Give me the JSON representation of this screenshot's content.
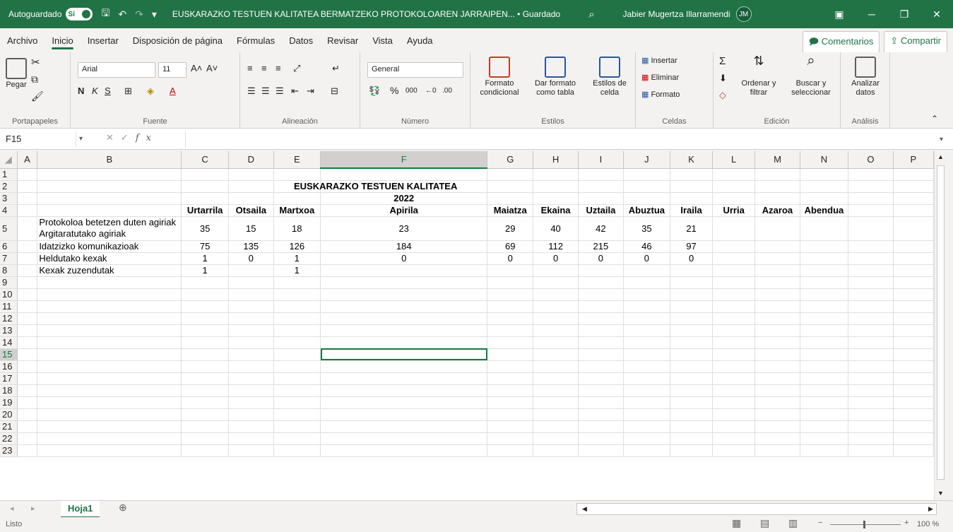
{
  "titlebar": {
    "autosave_label": "Autoguardado",
    "autosave_state": "Sí",
    "doc_title": "EUSKARAZKO TESTUEN KALITATEA BERMATZEKO PROTOKOLOAREN JARRAIPEN... • Guardado",
    "user_name": "Jabier Mugertza Illarramendi",
    "user_initials": "JM"
  },
  "menu": {
    "tabs": [
      "Archivo",
      "Inicio",
      "Insertar",
      "Disposición de página",
      "Fórmulas",
      "Datos",
      "Revisar",
      "Vista",
      "Ayuda"
    ],
    "active": "Inicio",
    "comments": "Comentarios",
    "share": "Compartir"
  },
  "ribbon": {
    "paste": "Pegar",
    "font_name": "Arial",
    "font_size": "11",
    "number_format": "General",
    "cond_format": "Formato condicional",
    "table_format": "Dar formato como tabla",
    "cell_styles": "Estilos de celda",
    "insert": "Insertar",
    "delete": "Eliminar",
    "format": "Formato",
    "sort": "Ordenar y filtrar",
    "find": "Buscar y seleccionar",
    "analyze": "Analizar datos",
    "groups": [
      "Portapapeles",
      "Fuente",
      "Alineación",
      "Número",
      "Estilos",
      "Celdas",
      "Edición",
      "Análisis"
    ]
  },
  "formula": {
    "namebox": "F15",
    "fx": "fx",
    "content": ""
  },
  "sheet": {
    "title": "EUSKARAZKO TESTUEN KALITATEA",
    "year": "2022",
    "months": [
      "Urtarrila",
      "Otsaila",
      "Martxoa",
      "Apirila",
      "Maiatza",
      "Ekaina",
      "Uztaila",
      "Abuztua",
      "Iraila",
      "Urria",
      "Azaroa",
      "Abendua"
    ],
    "rows": [
      {
        "label": "Protokoloa betetzen duten agiriak",
        "label2": "Argitaratutako agiriak",
        "values": [
          "35",
          "15",
          "18",
          "23",
          "29",
          "40",
          "42",
          "35",
          "21",
          "",
          "",
          ""
        ]
      },
      {
        "label": "Idatzizko komunikazioak",
        "values": [
          "75",
          "135",
          "126",
          "184",
          "69",
          "112",
          "215",
          "46",
          "97",
          "",
          "",
          ""
        ]
      },
      {
        "label": "Heldutako kexak",
        "values": [
          "1",
          "0",
          "1",
          "0",
          "0",
          "0",
          "0",
          "0",
          "0",
          "",
          "",
          ""
        ]
      },
      {
        "label": "Kexak zuzendutak",
        "values": [
          "1",
          "",
          "1",
          "",
          "",
          "",
          "",
          "",
          "",
          "",
          "",
          ""
        ]
      }
    ]
  },
  "sheetbar": {
    "tab": "Hoja1"
  },
  "status": {
    "ready": "Listo",
    "zoom": "100 %"
  }
}
